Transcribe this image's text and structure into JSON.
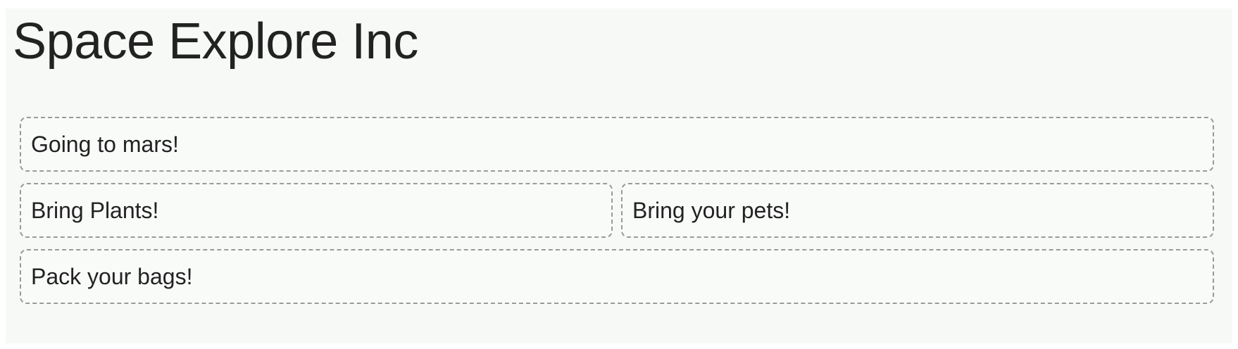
{
  "header": {
    "title": "Space Explore Inc"
  },
  "boxes": {
    "going_to_mars": "Going to mars!",
    "bring_plants": "Bring Plants!",
    "bring_pets": "Bring your pets!",
    "pack_bags": "Pack your bags!"
  }
}
